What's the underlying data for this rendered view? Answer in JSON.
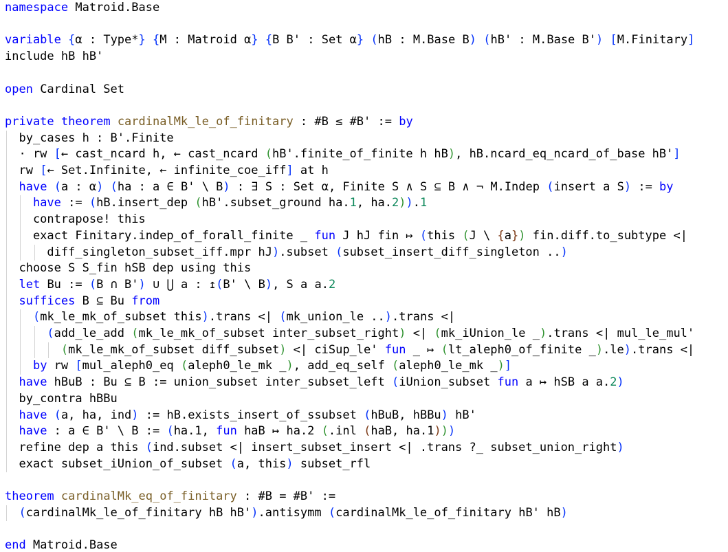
{
  "editor": {
    "theme": {
      "keyword": "#0000ff",
      "declaration_name": "#795e26",
      "number": "#098658",
      "bracket_level_1": "#0431fa",
      "bracket_level_2": "#319331",
      "bracket_level_3": "#7b3814",
      "indent_guide": "#d3d3d3"
    },
    "lines": [
      {
        "segments": [
          {
            "text": "namespace",
            "style": "kw"
          },
          {
            "text": " Matroid.Base"
          }
        ]
      },
      {
        "segments": []
      },
      {
        "segments": [
          {
            "text": "variable",
            "style": "kw"
          },
          {
            "text": " "
          },
          {
            "text": "{",
            "style": "br1"
          },
          {
            "text": "α : Type*"
          },
          {
            "text": "}",
            "style": "br1"
          },
          {
            "text": " "
          },
          {
            "text": "{",
            "style": "br1"
          },
          {
            "text": "M : Matroid α"
          },
          {
            "text": "}",
            "style": "br1"
          },
          {
            "text": " "
          },
          {
            "text": "{",
            "style": "br1"
          },
          {
            "text": "B B' : Set α"
          },
          {
            "text": "}",
            "style": "br1"
          },
          {
            "text": " "
          },
          {
            "text": "(",
            "style": "br1"
          },
          {
            "text": "hB : M.Base B"
          },
          {
            "text": ")",
            "style": "br1"
          },
          {
            "text": " "
          },
          {
            "text": "(",
            "style": "br1"
          },
          {
            "text": "hB' : M.Base B'"
          },
          {
            "text": ")",
            "style": "br1"
          },
          {
            "text": " "
          },
          {
            "text": "[",
            "style": "br1"
          },
          {
            "text": "M.Finitary"
          },
          {
            "text": "]",
            "style": "br1"
          }
        ]
      },
      {
        "segments": [
          {
            "text": "include hB hB'"
          }
        ]
      },
      {
        "segments": []
      },
      {
        "segments": [
          {
            "text": "open",
            "style": "kw"
          },
          {
            "text": " Cardinal Set"
          }
        ]
      },
      {
        "segments": []
      },
      {
        "segments": [
          {
            "text": "private",
            "style": "kw"
          },
          {
            "text": " "
          },
          {
            "text": "theorem",
            "style": "kw"
          },
          {
            "text": " "
          },
          {
            "text": "cardinalMk_le_of_finitary",
            "style": "fn"
          },
          {
            "text": " : #B ≤ #B' := "
          },
          {
            "text": "by",
            "style": "kw"
          }
        ]
      },
      {
        "segments": [
          {
            "text": "  by_cases h : B'.Finite"
          }
        ]
      },
      {
        "segments": [
          {
            "text": "  · rw "
          },
          {
            "text": "[",
            "style": "br1"
          },
          {
            "text": "← cast_ncard h, ← cast_ncard "
          },
          {
            "text": "(",
            "style": "br2"
          },
          {
            "text": "hB'.finite_of_finite h hB"
          },
          {
            "text": ")",
            "style": "br2"
          },
          {
            "text": ", hB.ncard_eq_ncard_of_base hB'"
          },
          {
            "text": "]",
            "style": "br1"
          }
        ]
      },
      {
        "segments": [
          {
            "text": "  rw "
          },
          {
            "text": "[",
            "style": "br1"
          },
          {
            "text": "← Set.Infinite, ← infinite_coe_iff"
          },
          {
            "text": "]",
            "style": "br1"
          },
          {
            "text": " at h"
          }
        ]
      },
      {
        "segments": [
          {
            "text": "  "
          },
          {
            "text": "have",
            "style": "kw"
          },
          {
            "text": " "
          },
          {
            "text": "(",
            "style": "br1"
          },
          {
            "text": "a : α"
          },
          {
            "text": ")",
            "style": "br1"
          },
          {
            "text": " "
          },
          {
            "text": "(",
            "style": "br1"
          },
          {
            "text": "ha : a ∈ B' \\ B"
          },
          {
            "text": ")",
            "style": "br1"
          },
          {
            "text": " : ∃ S : Set α, Finite S ∧ S ⊆ B ∧ ¬ M.Indep "
          },
          {
            "text": "(",
            "style": "br1"
          },
          {
            "text": "insert a S"
          },
          {
            "text": ")",
            "style": "br1"
          },
          {
            "text": " := "
          },
          {
            "text": "by",
            "style": "kw"
          }
        ]
      },
      {
        "segments": [
          {
            "text": "    "
          },
          {
            "text": "have",
            "style": "kw"
          },
          {
            "text": " := "
          },
          {
            "text": "(",
            "style": "br1"
          },
          {
            "text": "hB.insert_dep "
          },
          {
            "text": "(",
            "style": "br2"
          },
          {
            "text": "hB'.subset_ground ha."
          },
          {
            "text": "1",
            "style": "num"
          },
          {
            "text": ", ha."
          },
          {
            "text": "2",
            "style": "num"
          },
          {
            "text": ")",
            "style": "br2"
          },
          {
            "text": ")",
            "style": "br1"
          },
          {
            "text": "."
          },
          {
            "text": "1",
            "style": "num"
          }
        ]
      },
      {
        "segments": [
          {
            "text": "    contrapose! this"
          }
        ]
      },
      {
        "segments": [
          {
            "text": "    exact Finitary.indep_of_forall_finite _ "
          },
          {
            "text": "fun",
            "style": "kw"
          },
          {
            "text": " J hJ fin ↦ "
          },
          {
            "text": "(",
            "style": "br1"
          },
          {
            "text": "this "
          },
          {
            "text": "(",
            "style": "br2"
          },
          {
            "text": "J \\ "
          },
          {
            "text": "{",
            "style": "br3"
          },
          {
            "text": "a"
          },
          {
            "text": "}",
            "style": "br3"
          },
          {
            "text": ")",
            "style": "br2"
          },
          {
            "text": " fin.diff.to_subtype <|"
          }
        ]
      },
      {
        "segments": [
          {
            "text": "      diff_singleton_subset_iff.mpr hJ"
          },
          {
            "text": ")",
            "style": "br1"
          },
          {
            "text": ".subset "
          },
          {
            "text": "(",
            "style": "br1"
          },
          {
            "text": "subset_insert_diff_singleton .."
          },
          {
            "text": ")",
            "style": "br1"
          }
        ]
      },
      {
        "segments": [
          {
            "text": "  choose S S_fin hSB dep using this"
          }
        ]
      },
      {
        "segments": [
          {
            "text": "  "
          },
          {
            "text": "let",
            "style": "kw"
          },
          {
            "text": " Bu := "
          },
          {
            "text": "(",
            "style": "br1"
          },
          {
            "text": "B ∩ B'"
          },
          {
            "text": ")",
            "style": "br1"
          },
          {
            "text": " ∪ ⋃ a : ↥"
          },
          {
            "text": "(",
            "style": "br1"
          },
          {
            "text": "B' \\ B"
          },
          {
            "text": ")",
            "style": "br1"
          },
          {
            "text": ", S a a."
          },
          {
            "text": "2",
            "style": "num"
          }
        ]
      },
      {
        "segments": [
          {
            "text": "  "
          },
          {
            "text": "suffices",
            "style": "kw"
          },
          {
            "text": " B ⊆ Bu "
          },
          {
            "text": "from",
            "style": "kw"
          }
        ]
      },
      {
        "segments": [
          {
            "text": "    "
          },
          {
            "text": "(",
            "style": "br1"
          },
          {
            "text": "mk_le_mk_of_subset this"
          },
          {
            "text": ")",
            "style": "br1"
          },
          {
            "text": ".trans <| "
          },
          {
            "text": "(",
            "style": "br1"
          },
          {
            "text": "mk_union_le .."
          },
          {
            "text": ")",
            "style": "br1"
          },
          {
            "text": ".trans <|"
          }
        ]
      },
      {
        "segments": [
          {
            "text": "      "
          },
          {
            "text": "(",
            "style": "br1"
          },
          {
            "text": "add_le_add "
          },
          {
            "text": "(",
            "style": "br2"
          },
          {
            "text": "mk_le_mk_of_subset inter_subset_right"
          },
          {
            "text": ")",
            "style": "br2"
          },
          {
            "text": " <| "
          },
          {
            "text": "(",
            "style": "br2"
          },
          {
            "text": "mk_iUnion_le _"
          },
          {
            "text": ")",
            "style": "br2"
          },
          {
            "text": ".trans <| mul_le_mul'"
          }
        ]
      },
      {
        "segments": [
          {
            "text": "        "
          },
          {
            "text": "(",
            "style": "br2"
          },
          {
            "text": "mk_le_mk_of_subset diff_subset"
          },
          {
            "text": ")",
            "style": "br2"
          },
          {
            "text": " <| ciSup_le' "
          },
          {
            "text": "fun",
            "style": "kw"
          },
          {
            "text": " _ ↦ "
          },
          {
            "text": "(",
            "style": "br2"
          },
          {
            "text": "lt_aleph0_of_finite _"
          },
          {
            "text": ")",
            "style": "br2"
          },
          {
            "text": ".le"
          },
          {
            "text": ")",
            "style": "br1"
          },
          {
            "text": ".trans <|"
          }
        ]
      },
      {
        "segments": [
          {
            "text": "    "
          },
          {
            "text": "by",
            "style": "kw"
          },
          {
            "text": " rw "
          },
          {
            "text": "[",
            "style": "br1"
          },
          {
            "text": "mul_aleph0_eq "
          },
          {
            "text": "(",
            "style": "br2"
          },
          {
            "text": "aleph0_le_mk _"
          },
          {
            "text": ")",
            "style": "br2"
          },
          {
            "text": ", add_eq_self "
          },
          {
            "text": "(",
            "style": "br2"
          },
          {
            "text": "aleph0_le_mk _"
          },
          {
            "text": ")",
            "style": "br2"
          },
          {
            "text": "]",
            "style": "br1"
          }
        ]
      },
      {
        "segments": [
          {
            "text": "  "
          },
          {
            "text": "have",
            "style": "kw"
          },
          {
            "text": " hBuB : Bu ⊆ B := union_subset inter_subset_left "
          },
          {
            "text": "(",
            "style": "br1"
          },
          {
            "text": "iUnion_subset "
          },
          {
            "text": "fun",
            "style": "kw"
          },
          {
            "text": " a ↦ hSB a a."
          },
          {
            "text": "2",
            "style": "num"
          },
          {
            "text": ")",
            "style": "br1"
          }
        ]
      },
      {
        "segments": [
          {
            "text": "  by_contra hBBu"
          }
        ]
      },
      {
        "segments": [
          {
            "text": "  "
          },
          {
            "text": "have",
            "style": "kw"
          },
          {
            "text": " "
          },
          {
            "text": "(",
            "style": "br1"
          },
          {
            "text": "a, ha, ind"
          },
          {
            "text": ")",
            "style": "br1"
          },
          {
            "text": " := hB.exists_insert_of_ssubset "
          },
          {
            "text": "(",
            "style": "br1"
          },
          {
            "text": "hBuB, hBBu"
          },
          {
            "text": ")",
            "style": "br1"
          },
          {
            "text": " hB'"
          }
        ]
      },
      {
        "segments": [
          {
            "text": "  "
          },
          {
            "text": "have",
            "style": "kw"
          },
          {
            "text": " : a ∈ B' \\ B := "
          },
          {
            "text": "(",
            "style": "br1"
          },
          {
            "text": "ha.1, "
          },
          {
            "text": "fun",
            "style": "kw"
          },
          {
            "text": " haB ↦ ha.2 "
          },
          {
            "text": "(",
            "style": "br2"
          },
          {
            "text": ".inl "
          },
          {
            "text": "(",
            "style": "br3"
          },
          {
            "text": "haB, ha.1"
          },
          {
            "text": ")",
            "style": "br3"
          },
          {
            "text": ")",
            "style": "br2"
          },
          {
            "text": ")",
            "style": "br1"
          }
        ]
      },
      {
        "segments": [
          {
            "text": "  refine dep a this "
          },
          {
            "text": "(",
            "style": "br1"
          },
          {
            "text": "ind.subset <| insert_subset_insert <| .trans ?_ subset_union_right"
          },
          {
            "text": ")",
            "style": "br1"
          }
        ]
      },
      {
        "segments": [
          {
            "text": "  exact subset_iUnion_of_subset "
          },
          {
            "text": "(",
            "style": "br1"
          },
          {
            "text": "a, this"
          },
          {
            "text": ")",
            "style": "br1"
          },
          {
            "text": " subset_rfl"
          }
        ]
      },
      {
        "segments": []
      },
      {
        "segments": [
          {
            "text": "theorem",
            "style": "kw"
          },
          {
            "text": " "
          },
          {
            "text": "cardinalMk_eq_of_finitary",
            "style": "fn"
          },
          {
            "text": " : #B = #B' :="
          }
        ]
      },
      {
        "segments": [
          {
            "text": "  "
          },
          {
            "text": "(",
            "style": "br1"
          },
          {
            "text": "cardinalMk_le_of_finitary hB hB'"
          },
          {
            "text": ")",
            "style": "br1"
          },
          {
            "text": ".antisymm "
          },
          {
            "text": "(",
            "style": "br1"
          },
          {
            "text": "cardinalMk_le_of_finitary hB' hB"
          },
          {
            "text": ")",
            "style": "br1"
          }
        ]
      },
      {
        "segments": []
      },
      {
        "segments": [
          {
            "text": "end",
            "style": "kw"
          },
          {
            "text": " Matroid.Base"
          }
        ]
      }
    ]
  }
}
